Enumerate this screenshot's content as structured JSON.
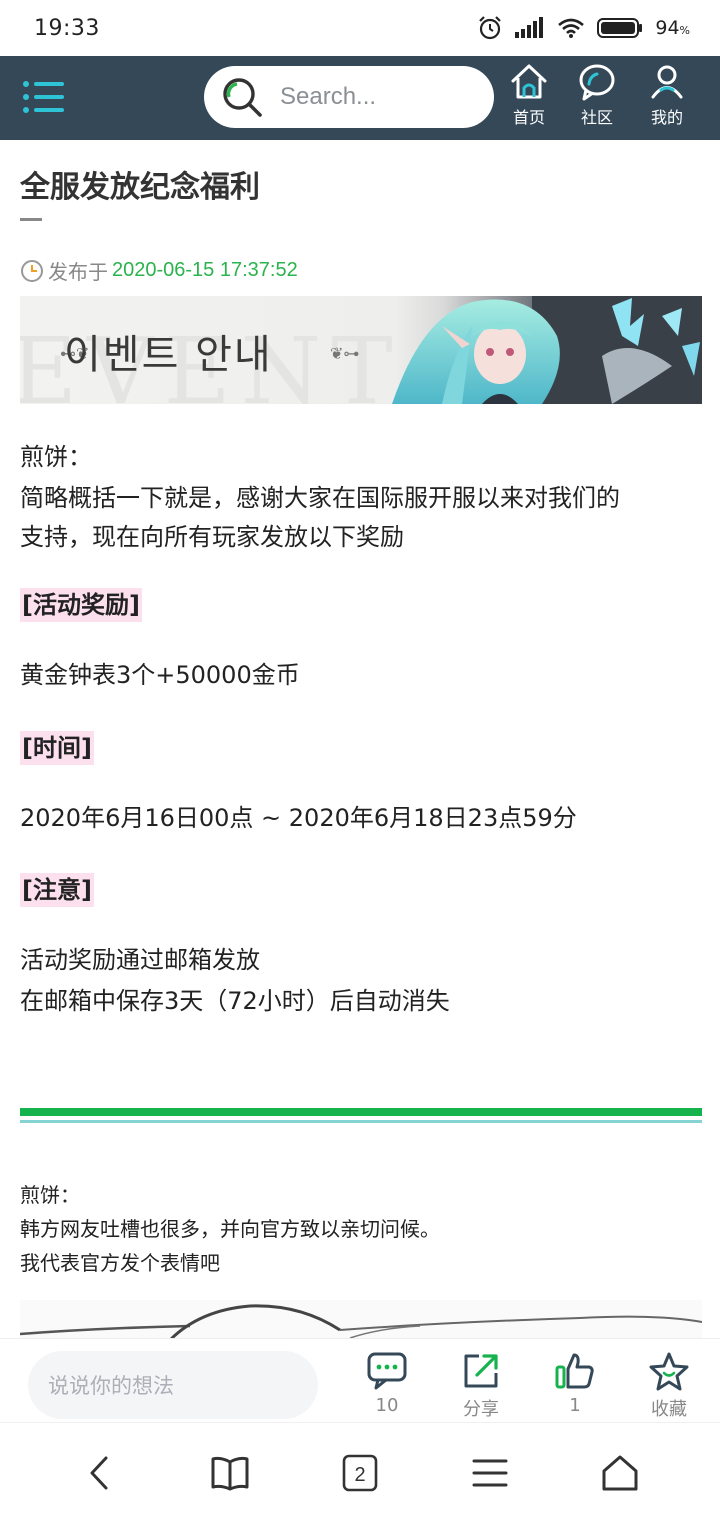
{
  "status_bar": {
    "time": "19:33",
    "battery_percent": "94",
    "battery_unit": "%"
  },
  "header": {
    "search_placeholder": "Search...",
    "nav": [
      {
        "label": "首页",
        "icon": "home-icon"
      },
      {
        "label": "社区",
        "icon": "chat-bubble-icon"
      },
      {
        "label": "我的",
        "icon": "user-icon"
      }
    ]
  },
  "article": {
    "title": "全服发放纪念福利",
    "published_prefix": "发布于",
    "published_at": "2020-06-15 17:37:52",
    "banner": {
      "korean_text": "이벤트 안내",
      "bg_text": "EVENT"
    },
    "intro_author": "煎饼：",
    "intro_line1": "简略概括一下就是，感谢大家在国际服开服以来对我们的",
    "intro_line2": "支持，现在向所有玩家发放以下奖励",
    "section_reward_tag": "[活动奖励]",
    "section_reward_text": "黄金钟表3个+50000金币",
    "section_time_tag": "[时间]",
    "section_time_text": "2020年6月16日00点 ~ 2020年6月18日23点59分",
    "section_note_tag": "[注意]",
    "section_note_line1": "活动奖励通过邮箱发放",
    "section_note_line2": "在邮箱中保存3天（72小时）后自动消失",
    "second_author": "煎饼：",
    "second_line1": "韩方网友吐槽也很多，并向官方致以亲切问候。",
    "second_line2": "我代表官方发个表情吧"
  },
  "comment_bar": {
    "input_placeholder": "说说你的想法",
    "comment_count": "10",
    "share_label": "分享",
    "like_count": "1",
    "favorite_label": "收藏"
  },
  "system_nav": {
    "tabs_count": "2"
  },
  "colors": {
    "header_bg": "#344858",
    "accent_teal": "#2ec4d6",
    "date_green": "#2bb34d",
    "divider_green": "#16b24e",
    "tag_bg": "#fde0ee"
  }
}
